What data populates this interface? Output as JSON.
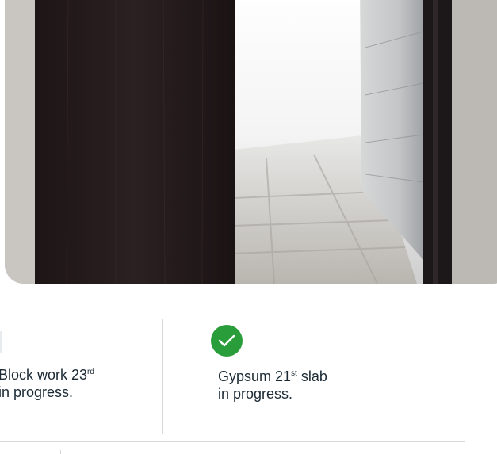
{
  "photo": {
    "alt": "Construction site doorway view"
  },
  "statuses": [
    {
      "text_main": "Block work 23",
      "ordinal": "rd",
      "text_rest": "in progress."
    },
    {
      "text_main": "Gypsum 21",
      "ordinal": "st",
      "text_tail": " slab",
      "text_rest": "in progress."
    }
  ],
  "colors": {
    "check_green": "#2a9d3b",
    "divider": "#d6d9dc",
    "text": "#1b2a34"
  }
}
